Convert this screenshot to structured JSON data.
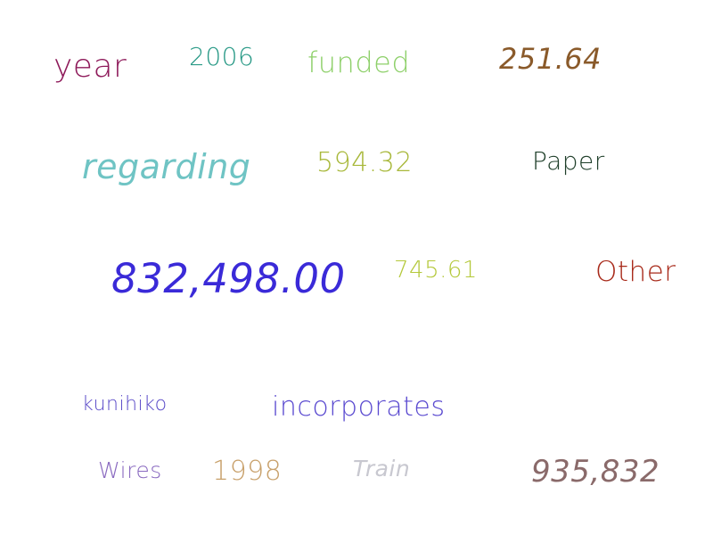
{
  "words": [
    {
      "text": "year",
      "color": "#8e1a5a",
      "italic": false
    },
    {
      "text": "2006",
      "color": "#2a9a87",
      "italic": false
    },
    {
      "text": "funded",
      "color": "#8ed06a",
      "italic": false
    },
    {
      "text": "251.64",
      "color": "#8a5a2a",
      "italic": true
    },
    {
      "text": "regarding",
      "color": "#6fc4c4",
      "italic": true
    },
    {
      "text": "594.32",
      "color": "#a8b83a",
      "italic": false
    },
    {
      "text": "Paper",
      "color": "#1f3f2a",
      "italic": false
    },
    {
      "text": "832,498.00",
      "color": "#3a2ad8",
      "italic": true
    },
    {
      "text": "745.61",
      "color": "#b4c83a",
      "italic": false
    },
    {
      "text": "Other",
      "color": "#a82a1a",
      "italic": false
    },
    {
      "text": "kunihiko",
      "color": "#5a4ac8",
      "italic": false
    },
    {
      "text": "incorporates",
      "color": "#5a4ad0",
      "italic": false
    },
    {
      "text": "Wires",
      "color": "#8a6ac0",
      "italic": false
    },
    {
      "text": "1998",
      "color": "#c8a06a",
      "italic": false
    },
    {
      "text": "Train",
      "color": "#c8c8d0",
      "italic": true
    },
    {
      "text": "935,832",
      "color": "#8a6a6a",
      "italic": true
    }
  ]
}
